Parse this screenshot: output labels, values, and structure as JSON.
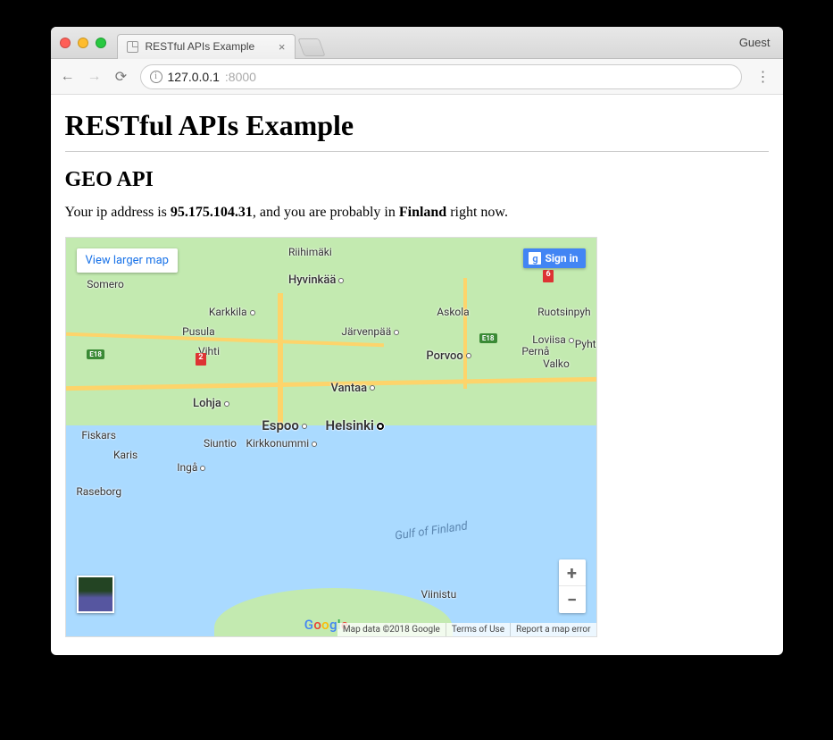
{
  "browser": {
    "tab_title": "RESTful APIs Example",
    "guest_label": "Guest",
    "address_host": "127.0.0.1",
    "address_port": ":8000"
  },
  "page": {
    "h1": "RESTful APIs Example",
    "h2": "GEO API",
    "ip_intro": "Your ip address is ",
    "ip_value": "95.175.104.31",
    "ip_mid": ", and you are probably in ",
    "country": "Finland",
    "ip_end": " right now."
  },
  "map": {
    "view_larger": "View larger map",
    "sign_in": "Sign in",
    "gulf": "Gulf of Finland",
    "logo": "Google",
    "attribution": {
      "data": "Map data ©2018 Google",
      "terms": "Terms of Use",
      "report": "Report a map error"
    },
    "zoom_in": "+",
    "zoom_out": "−",
    "shields": {
      "e18": "E18",
      "r2": "2",
      "r6": "6"
    },
    "cities": {
      "riihimaki": "Riihimäki",
      "somero": "Somero",
      "hyvinkaa": "Hyvinkää",
      "karkkila": "Karkkila",
      "askola": "Askola",
      "ruotsinpyh": "Ruotsinpyh",
      "pusula": "Pusula",
      "jarvenpaa": "Järvenpää",
      "loviisa": "Loviisa",
      "perna": "Pernå",
      "pyhta": "Pyhtä",
      "vihti": "Vihti",
      "porvoo": "Porvoo",
      "valko": "Valko",
      "vantaa": "Vantaa",
      "lohja": "Lohja",
      "espoo": "Espoo",
      "helsinki": "Helsinki",
      "fiskars": "Fiskars",
      "siuntio": "Siuntio",
      "kirkkonummi": "Kirkkonummi",
      "karis": "Karis",
      "inga": "Ingå",
      "raseborg": "Raseborg",
      "viinistu": "Viinistu"
    }
  }
}
